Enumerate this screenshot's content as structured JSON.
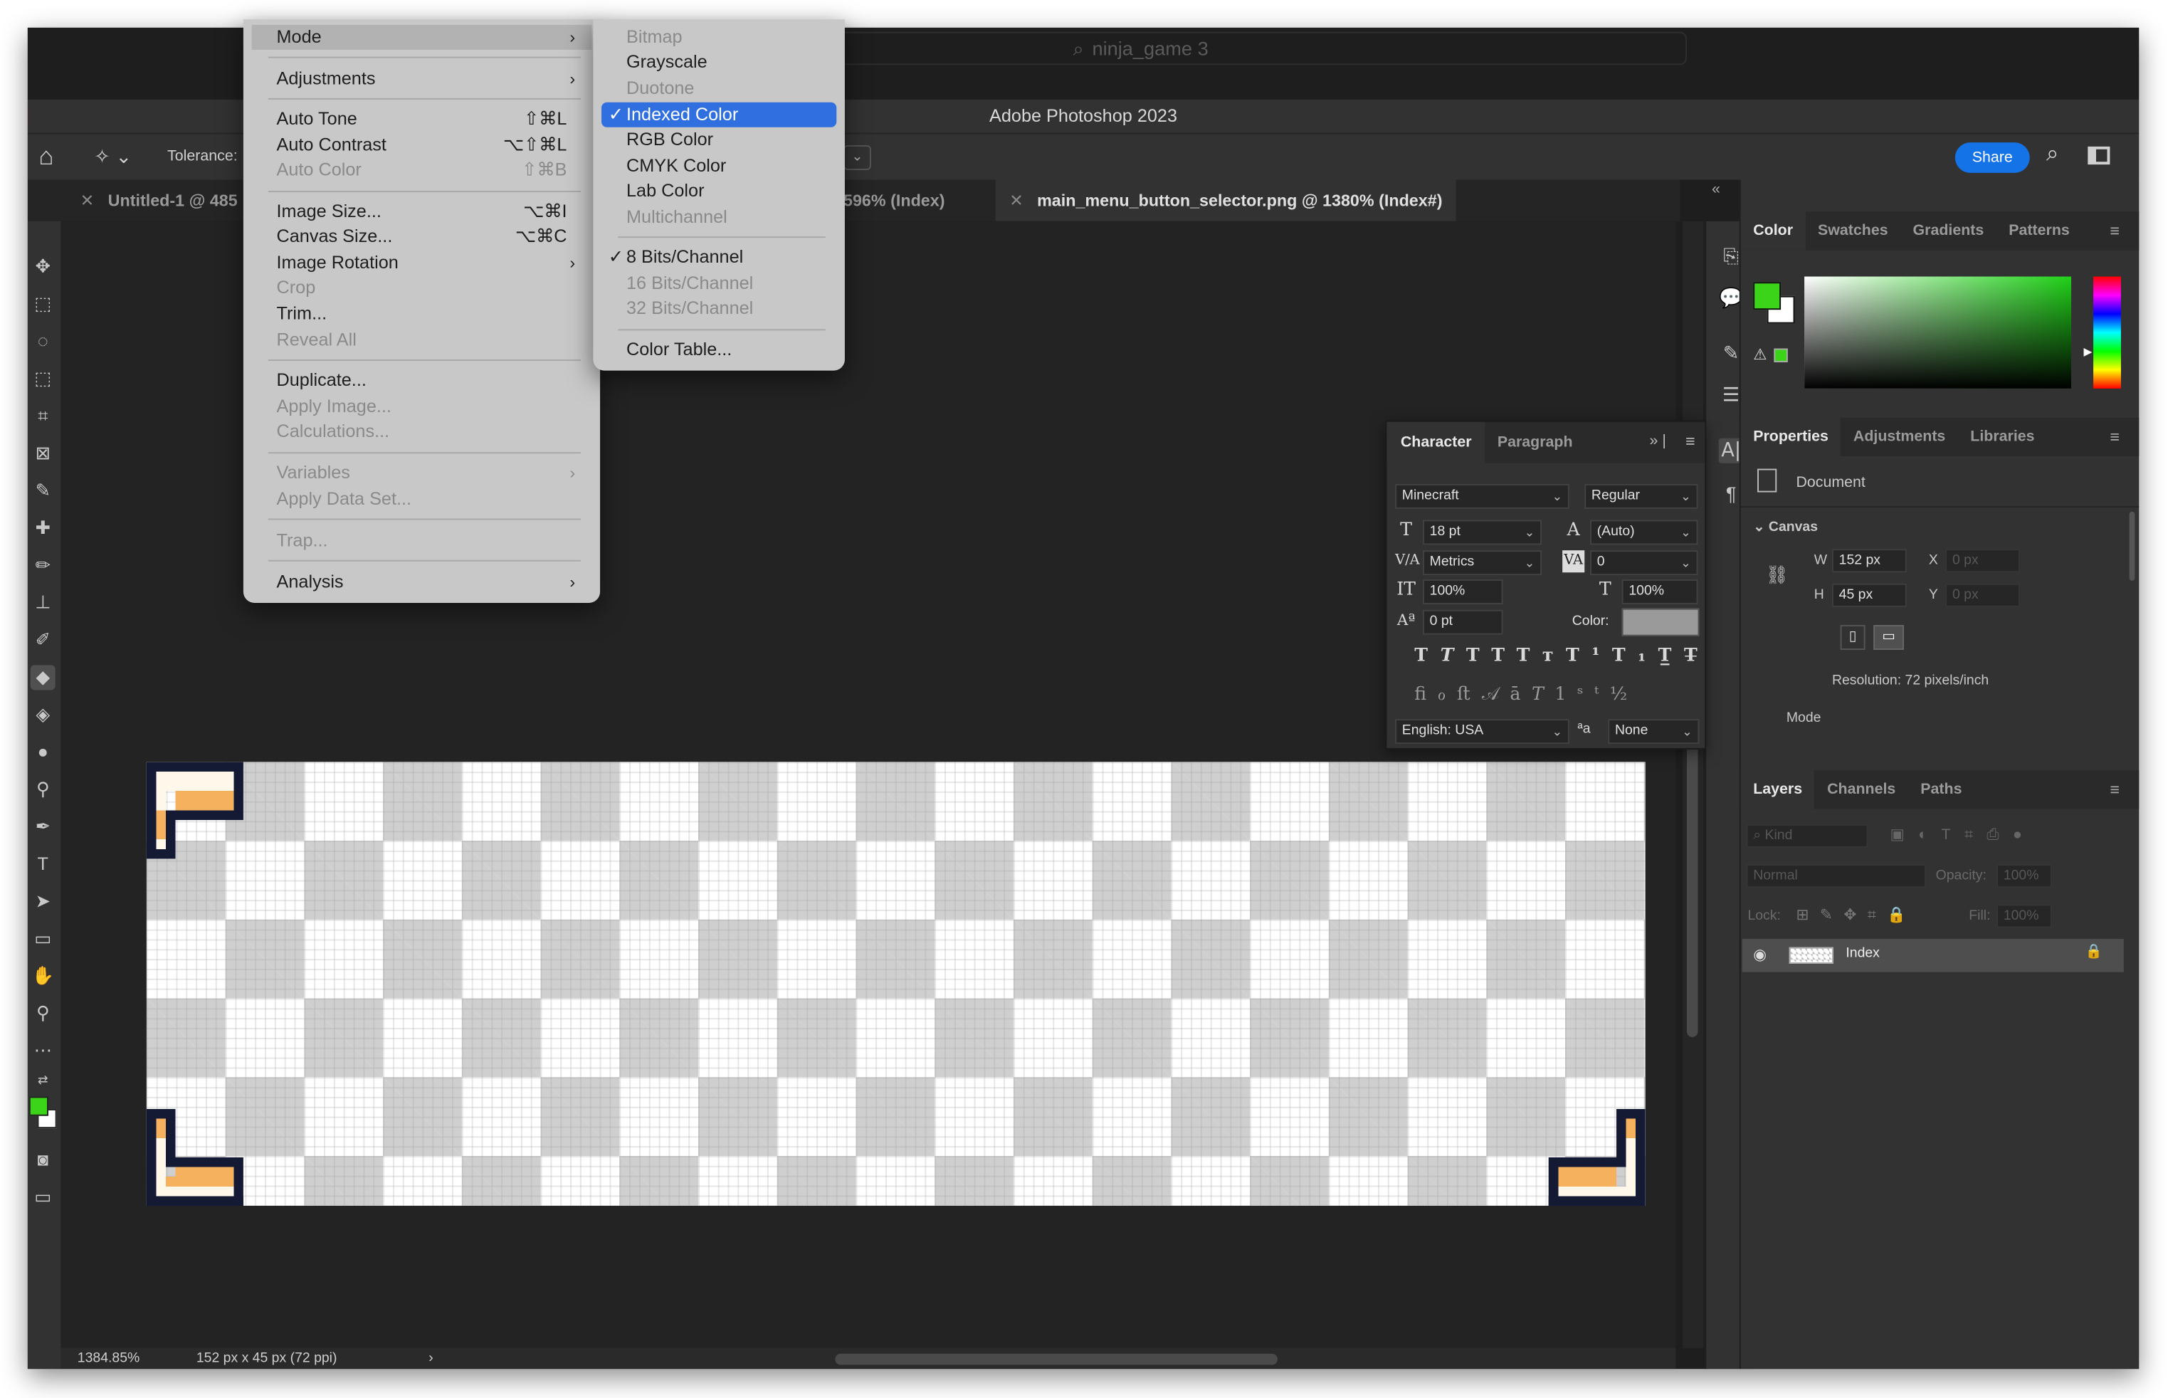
{
  "search": {
    "text": "ninja_game 3",
    "icon": "search-icon"
  },
  "window": {
    "title": "Adobe Photoshop 2023"
  },
  "options": {
    "tolerance_label": "Tolerance:",
    "share": "Share"
  },
  "tabs": [
    {
      "label": "Untitled-1 @ 485"
    },
    {
      "label": "596% (Index)"
    },
    {
      "label": "main_menu_button_selector.png @ 1380% (Index#)"
    }
  ],
  "status": {
    "zoom": "1384.85%",
    "dimensions": "152 px x 45 px (72 ppi)"
  },
  "image_menu": {
    "mode": "Mode",
    "adjustments": "Adjustments",
    "auto_tone": "Auto Tone",
    "auto_tone_sc": "⇧⌘L",
    "auto_contrast": "Auto Contrast",
    "auto_contrast_sc": "⌥⇧⌘L",
    "auto_color": "Auto Color",
    "auto_color_sc": "⇧⌘B",
    "image_size": "Image Size...",
    "image_size_sc": "⌥⌘I",
    "canvas_size": "Canvas Size...",
    "canvas_size_sc": "⌥⌘C",
    "image_rotation": "Image Rotation",
    "crop": "Crop",
    "trim": "Trim...",
    "reveal_all": "Reveal All",
    "duplicate": "Duplicate...",
    "apply_image": "Apply Image...",
    "calculations": "Calculations...",
    "variables": "Variables",
    "apply_data_set": "Apply Data Set...",
    "trap": "Trap...",
    "analysis": "Analysis"
  },
  "mode_menu": {
    "bitmap": "Bitmap",
    "grayscale": "Grayscale",
    "duotone": "Duotone",
    "indexed": "Indexed Color",
    "rgb": "RGB Color",
    "cmyk": "CMYK Color",
    "lab": "Lab Color",
    "multichannel": "Multichannel",
    "bits8": "8 Bits/Channel",
    "bits16": "16 Bits/Channel",
    "bits32": "32 Bits/Channel",
    "color_table": "Color Table...",
    "checkmark": "✓"
  },
  "color_panel": {
    "tabs": [
      "Color",
      "Swatches",
      "Gradients",
      "Patterns"
    ],
    "foreground": "#3cd418",
    "background": "#ffffff"
  },
  "properties_panel": {
    "tabs": [
      "Properties",
      "Adjustments",
      "Libraries"
    ],
    "document": "Document",
    "section": "Canvas",
    "w_label": "W",
    "w_value": "152 px",
    "h_label": "H",
    "h_value": "45 px",
    "x_label": "X",
    "x_value": "0 px",
    "y_label": "Y",
    "y_value": "0 px",
    "resolution": "Resolution: 72 pixels/inch",
    "mode_label": "Mode"
  },
  "layers_panel": {
    "tabs": [
      "Layers",
      "Channels",
      "Paths"
    ],
    "kind": "Kind",
    "blend": "Normal",
    "opacity_label": "Opacity:",
    "opacity": "100%",
    "lock_label": "Lock:",
    "fill_label": "Fill:",
    "fill": "100%",
    "layer_name": "Index"
  },
  "character_panel": {
    "tabs": [
      "Character",
      "Paragraph"
    ],
    "font": "Minecraft",
    "style": "Regular",
    "size": "18 pt",
    "leading": "(Auto)",
    "kerning": "Metrics",
    "tracking": "0",
    "vscale": "100%",
    "hscale": "100%",
    "baseline": "0 pt",
    "color_label": "Color:",
    "language": "English: USA",
    "aa_label": "a",
    "antialias": "None"
  }
}
